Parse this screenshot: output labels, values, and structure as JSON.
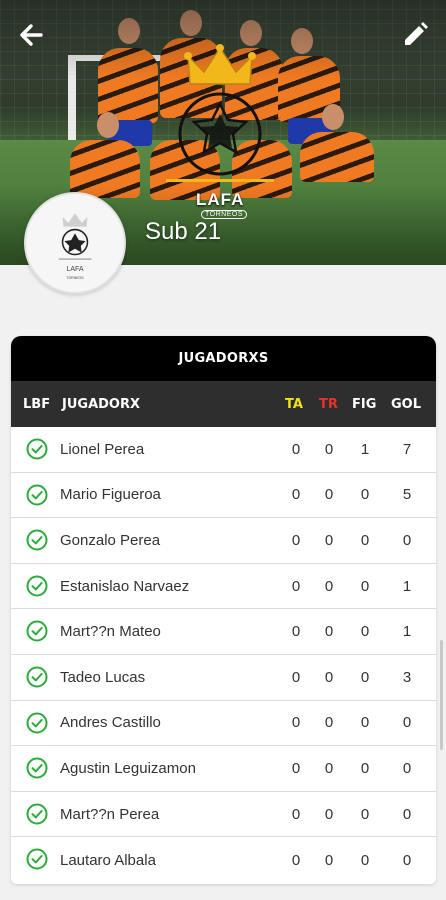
{
  "header": {
    "team_name": "Sub 21",
    "logo_text": "LAFA",
    "logo_subtext": "TORNEOS",
    "back_icon": "arrow-left-icon",
    "edit_icon": "pencil-icon"
  },
  "table": {
    "title": "JUGADORXS",
    "columns": {
      "lbf": "LBF",
      "player": "JUGADORX",
      "ta": "TA",
      "tr": "TR",
      "fig": "FIG",
      "gol": "GOL"
    },
    "colors": {
      "ta": "#f2e21a",
      "tr": "#e5332a",
      "check": "#2bab3c"
    },
    "rows": [
      {
        "name": "Lionel Perea",
        "ta": "0",
        "tr": "0",
        "fig": "1",
        "gol": "7"
      },
      {
        "name": "Mario Figueroa",
        "ta": "0",
        "tr": "0",
        "fig": "0",
        "gol": "5"
      },
      {
        "name": "Gonzalo Perea",
        "ta": "0",
        "tr": "0",
        "fig": "0",
        "gol": "0"
      },
      {
        "name": "Estanislao Narvaez",
        "ta": "0",
        "tr": "0",
        "fig": "0",
        "gol": "1"
      },
      {
        "name": "Mart??n Mateo",
        "ta": "0",
        "tr": "0",
        "fig": "0",
        "gol": "1"
      },
      {
        "name": "Tadeo Lucas",
        "ta": "0",
        "tr": "0",
        "fig": "0",
        "gol": "3"
      },
      {
        "name": "Andres Castillo",
        "ta": "0",
        "tr": "0",
        "fig": "0",
        "gol": "0"
      },
      {
        "name": "Agustin Leguizamon",
        "ta": "0",
        "tr": "0",
        "fig": "0",
        "gol": "0"
      },
      {
        "name": "Mart??n Perea",
        "ta": "0",
        "tr": "0",
        "fig": "0",
        "gol": "0"
      },
      {
        "name": "Lautaro Albala",
        "ta": "0",
        "tr": "0",
        "fig": "0",
        "gol": "0"
      }
    ]
  }
}
